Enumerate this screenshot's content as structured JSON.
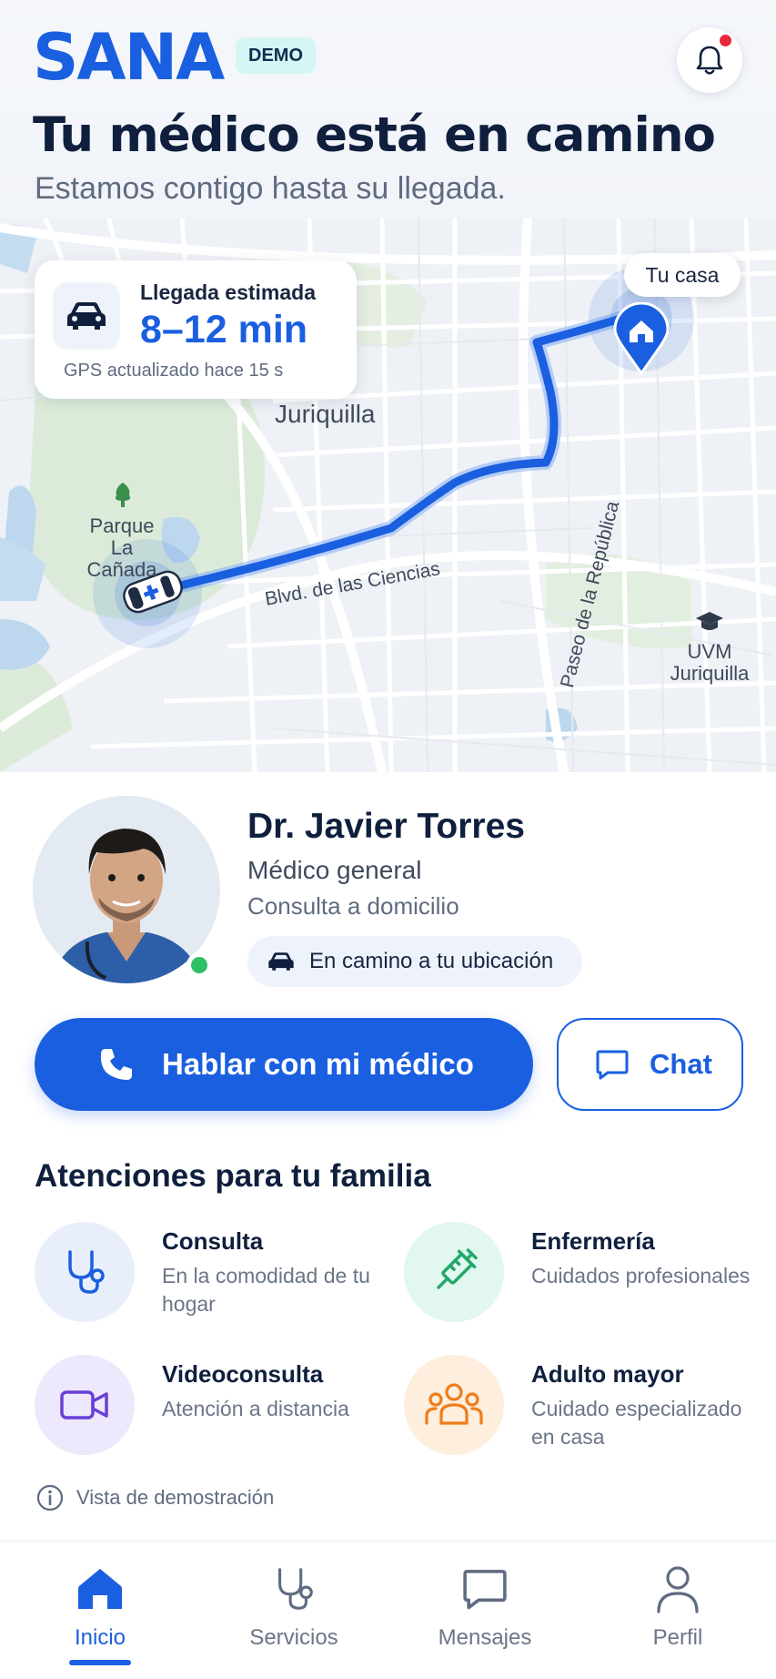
{
  "header": {
    "logo": "SANA",
    "badge": "DEMO",
    "title": "Tu médico está en camino",
    "subtitle": "Estamos contigo hasta su llegada."
  },
  "map": {
    "eta_label": "Llegada estimada",
    "eta_value": "8–12 min",
    "gps_status": "GPS actualizado hace 15 s",
    "destination_label": "Tu casa",
    "area_label": "Juriquilla",
    "park_label_1": "Parque",
    "park_label_2": "La Cañada",
    "street_1": "Blvd. de las Ciencias",
    "street_2": "Paseo de la República",
    "poi_label_1": "UVM",
    "poi_label_2": "Juriquilla",
    "route_color": "#1a5fe0"
  },
  "doctor": {
    "name": "Dr. Javier Torres",
    "role": "Médico general",
    "visit_type": "Consulta a domicilio",
    "status": "En camino a tu ubicación",
    "online_color": "#2fbf64"
  },
  "actions": {
    "call_label": "Hablar con mi médico",
    "chat_label": "Chat"
  },
  "family": {
    "title": "Atenciones para tu familia",
    "services": [
      {
        "title": "Consulta",
        "desc": "En la comodidad de tu hogar",
        "icon": "stethoscope-icon"
      },
      {
        "title": "Enfermería",
        "desc": "Cuidados profesionales",
        "icon": "syringe-icon"
      },
      {
        "title": "Videoconsulta",
        "desc": "Atención a distancia",
        "icon": "video-camera-icon"
      },
      {
        "title": "Adulto mayor",
        "desc": "Cuidado especializado en casa",
        "icon": "people-group-icon"
      }
    ]
  },
  "demo_note": "Vista de demostración",
  "nav": {
    "items": [
      {
        "label": "Inicio",
        "icon": "home-icon",
        "active": true
      },
      {
        "label": "Servicios",
        "icon": "stethoscope-icon",
        "active": false
      },
      {
        "label": "Mensajes",
        "icon": "message-icon",
        "active": false
      },
      {
        "label": "Perfil",
        "icon": "user-icon",
        "active": false
      }
    ]
  },
  "colors": {
    "primary": "#1a5fe0",
    "notification_dot": "#e62a3a"
  }
}
